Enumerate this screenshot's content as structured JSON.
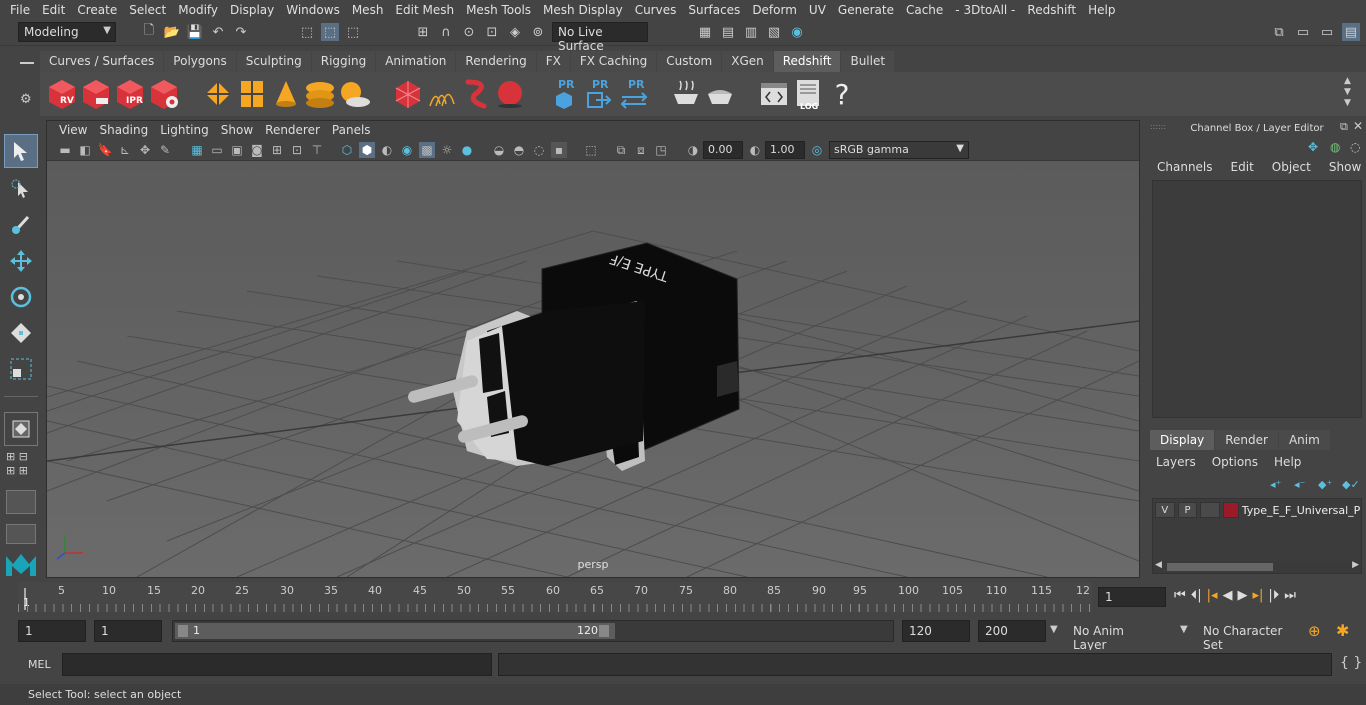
{
  "menubar": [
    "File",
    "Edit",
    "Create",
    "Select",
    "Modify",
    "Display",
    "Windows",
    "Mesh",
    "Edit Mesh",
    "Mesh Tools",
    "Mesh Display",
    "Curves",
    "Surfaces",
    "Deform",
    "UV",
    "Generate",
    "Cache",
    "- 3DtoAll -",
    "Redshift",
    "Help"
  ],
  "status": {
    "mode": "Modeling",
    "live_surface": "No Live Surface"
  },
  "shelf_tabs": [
    "Curves / Surfaces",
    "Polygons",
    "Sculpting",
    "Rigging",
    "Animation",
    "Rendering",
    "FX",
    "FX Caching",
    "Custom",
    "XGen",
    "Redshift",
    "Bullet"
  ],
  "shelf_active": "Redshift",
  "shelf_icon_labels": {
    "rv": "RV",
    "ipr": "IPR",
    "pr1": "PR",
    "pr2": "PR",
    "pr3": "PR",
    "log": "LOG",
    "help": "?"
  },
  "viewport": {
    "menu": [
      "View",
      "Shading",
      "Lighting",
      "Show",
      "Renderer",
      "Panels"
    ],
    "exposure": "0.00",
    "gamma": "1.00",
    "colorspace": "sRGB gamma",
    "camera": "persp",
    "model_text": "TYPE E/F"
  },
  "channelbox": {
    "title": "Channel Box / Layer Editor",
    "menu": [
      "Channels",
      "Edit",
      "Object",
      "Show"
    ],
    "display_tabs": [
      "Display",
      "Render",
      "Anim"
    ],
    "display_active": "Display",
    "layer_menu": [
      "Layers",
      "Options",
      "Help"
    ],
    "layer": {
      "v": "V",
      "p": "P",
      "name": "Type_E_F_Universal_Pl",
      "color": "#9b1a2a"
    }
  },
  "timeline": {
    "ticks": [
      "5",
      "10",
      "15",
      "20",
      "25",
      "30",
      "35",
      "40",
      "45",
      "50",
      "55",
      "60",
      "65",
      "70",
      "75",
      "80",
      "85",
      "90",
      "95",
      "100",
      "105",
      "110",
      "115",
      "12"
    ],
    "current_marker": "1",
    "current_frame": "1"
  },
  "range": {
    "start": "1",
    "playback_start": "1",
    "slider_start": "1",
    "slider_end": "120",
    "end": "120",
    "max_end": "200",
    "anim_layer": "No Anim Layer",
    "char_set": "No Character Set"
  },
  "mel": {
    "label": "MEL"
  },
  "helpline": "Select Tool: select an object"
}
